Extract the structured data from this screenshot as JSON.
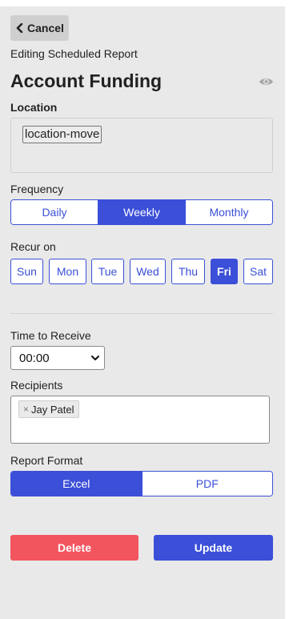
{
  "header": {
    "cancel_label": "Cancel",
    "subtitle": "Editing Scheduled Report",
    "title": "Account Funding",
    "eye_icon": "eye-icon"
  },
  "location": {
    "label": "Location",
    "tag": "location-move"
  },
  "frequency": {
    "label": "Frequency",
    "options": [
      "Daily",
      "Weekly",
      "Monthly"
    ],
    "selected": "Weekly"
  },
  "recur": {
    "label": "Recur on",
    "days": [
      "Sun",
      "Mon",
      "Tue",
      "Wed",
      "Thu",
      "Fri",
      "Sat"
    ],
    "selected": "Fri"
  },
  "time": {
    "label": "Time to Receive",
    "value": "00:00"
  },
  "recipients": {
    "label": "Recipients",
    "items": [
      "Jay Patel"
    ]
  },
  "format": {
    "label": "Report Format",
    "options": [
      "Excel",
      "PDF"
    ],
    "selected": "Excel"
  },
  "actions": {
    "delete_label": "Delete",
    "update_label": "Update"
  },
  "colors": {
    "accent": "#3b4fd8",
    "danger": "#f3555f",
    "panel_bg": "#e9e9e9"
  }
}
